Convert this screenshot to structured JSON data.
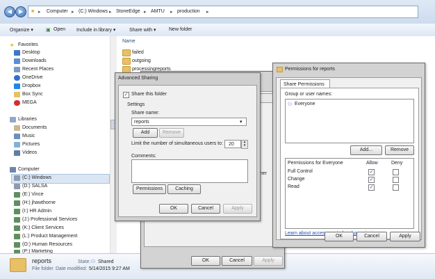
{
  "explorer": {
    "address": [
      "Computer",
      "(C:) Windows",
      "StoneEdge",
      "AMTU",
      "production"
    ],
    "toolbar": {
      "organize": "Organize ▾",
      "open": "Open",
      "include": "Include in library ▾",
      "share": "Share with ▾",
      "new_folder": "New folder"
    },
    "nav": {
      "favorites": "Favorites",
      "favorite_items": [
        "Desktop",
        "Downloads",
        "Recent Places",
        "OneDrive",
        "Dropbox",
        "Box Sync",
        "MEGA"
      ],
      "libraries": "Libraries",
      "library_items": [
        "Documents",
        "Music",
        "Pictures",
        "Videos"
      ],
      "computer": "Computer",
      "drives": [
        "(C:) Windows",
        "(D:) SALSA",
        "(E:) Vince",
        "(H:) jhawthorne",
        "(I:) HR Admin",
        "(J:) Professional Services",
        "(K:) Client Services",
        "(L:) Product Management",
        "(O:) Human Resources",
        "(P:) Marketing"
      ]
    },
    "list": {
      "header": "Name",
      "items": [
        "failed",
        "outgoing",
        "processingreports"
      ],
      "partial": "other"
    },
    "details": {
      "name": "reports",
      "type": "File folder",
      "state_label": "State:",
      "state_value": "Shared",
      "date_label": "Date modified:",
      "date_value": "5/14/2015 9:27 AM"
    }
  },
  "props_dialog": {
    "ok": "OK",
    "cancel": "Cancel",
    "apply": "Apply"
  },
  "advanced_sharing": {
    "title": "Advanced Sharing",
    "share_checkbox": "Share this folder",
    "share_checked": true,
    "settings": "Settings",
    "share_name_label": "Share name:",
    "share_name": "reports",
    "add": "Add",
    "remove": "Remove",
    "limit_label": "Limit the number of simultaneous users to:",
    "limit_value": "20",
    "comments_label": "Comments:",
    "permissions": "Permissions",
    "caching": "Caching",
    "ok": "OK",
    "cancel": "Cancel",
    "apply": "Apply"
  },
  "permissions": {
    "title": "Permissions for reports",
    "tab": "Share Permissions",
    "group_label": "Group or user names:",
    "users": [
      "Everyone"
    ],
    "add": "Add...",
    "remove": "Remove",
    "perm_for": "Permissions for Everyone",
    "allow": "Allow",
    "deny": "Deny",
    "rows": [
      {
        "name": "Full Control",
        "allow": true,
        "deny": false
      },
      {
        "name": "Change",
        "allow": true,
        "deny": false
      },
      {
        "name": "Read",
        "allow": true,
        "deny": false
      }
    ],
    "link": "Learn about access control and permissions",
    "ok": "OK",
    "cancel": "Cancel",
    "apply": "Apply"
  },
  "colors": {
    "link": "#1f4fb4",
    "folder": "#e8c065"
  }
}
